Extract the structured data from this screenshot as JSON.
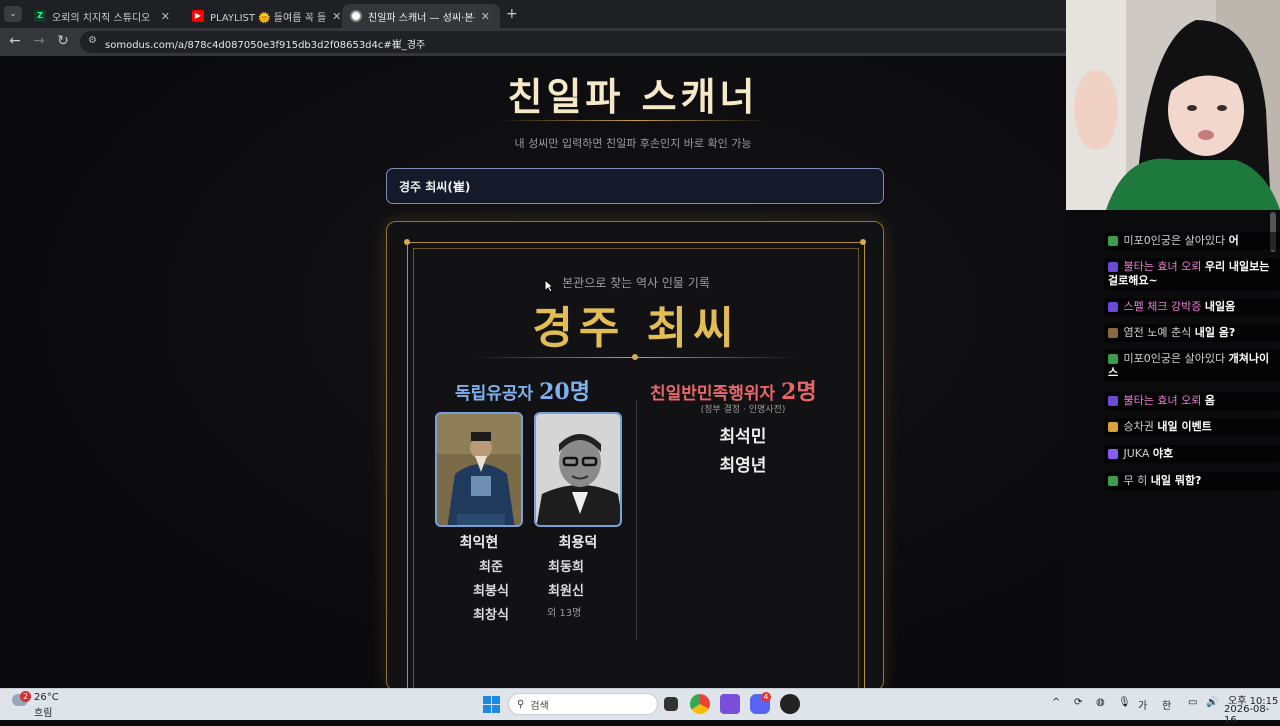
{
  "browser": {
    "tabs": [
      {
        "label": "오뢰의 치지직 스튜디오",
        "active": false
      },
      {
        "label": "PLAYLIST 🌞 들여름 꼭 들",
        "active": false
      },
      {
        "label": "친일파 스캐너 — 성씨·본관으로",
        "active": true
      }
    ],
    "new_tab": "+",
    "url": "somodus.com/a/878c4d087050e3f915db3d2f08653d4c#崔_경주"
  },
  "page": {
    "title": "친일파 스캐너",
    "subtitle": "내 성씨만 입력하면 친일파 후손인지 바로 확인 가능",
    "search_value": "경주 최씨(崔)"
  },
  "card": {
    "subtitle": "본관으로 찾는 역사 인물 기록",
    "clan": "경주 최씨",
    "independence": {
      "label": "독립유공자",
      "count": "20명",
      "featured": [
        "최익현",
        "최용덕"
      ],
      "others_left": [
        "최준",
        "최봉식",
        "최창식"
      ],
      "others_right": [
        "최동희",
        "최원신"
      ],
      "more": "외 13명"
    },
    "collaborators": {
      "label": "친일반민족행위자",
      "count": "2명",
      "note": "(정부 결정 · 인명사전)",
      "names": [
        "최석민",
        "최영년"
      ]
    }
  },
  "chat": {
    "messages": [
      {
        "nick": "미포0인궁은 살아있다",
        "msg": "어",
        "color": "#cfcfcf"
      },
      {
        "nick": "불타는 효녀 오뢰",
        "msg": "우리 내일보는걸로해요~",
        "color": "#e97fd3"
      },
      {
        "nick": "스펠 체크 강박증",
        "msg": "내일옴",
        "color": "#e97fd3"
      },
      {
        "nick": "염전 노예 춘식",
        "msg": "내일 옴?",
        "color": "#cfcfcf"
      },
      {
        "nick": "미포0인궁은 살아있다",
        "msg": "개쳐나이스",
        "color": "#cfcfcf"
      },
      {
        "nick": "불타는 효녀 오뢰",
        "msg": "옴",
        "color": "#e97fd3"
      },
      {
        "nick": "승차권",
        "msg": "내일 이벤트",
        "color": "#cfcfcf"
      },
      {
        "nick": "JUKA",
        "msg": "야호",
        "color": "#cfcfcf"
      },
      {
        "nick": "무 히",
        "msg": "내일 뭐함?",
        "color": "#cfcfcf"
      }
    ]
  },
  "taskbar": {
    "weather_temp": "26°C",
    "weather_desc": "흐림",
    "weather_badge": "2",
    "search_placeholder": "검색",
    "ime1": "가",
    "ime2": "한",
    "time": "오후 10:15",
    "date": "2026-08-16",
    "discord_badge": "4"
  }
}
